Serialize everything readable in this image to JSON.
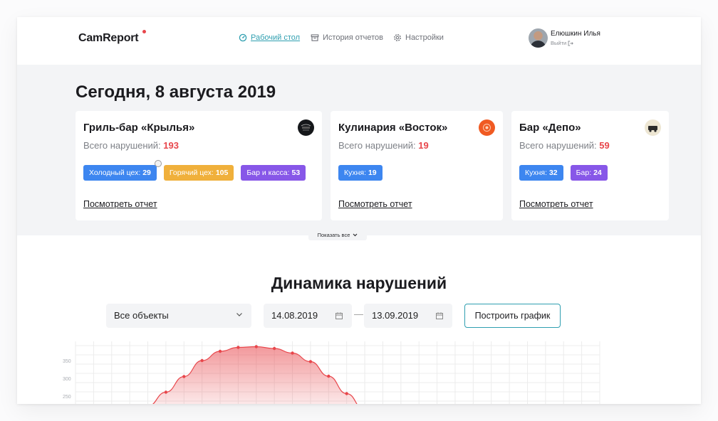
{
  "app": {
    "name": "CamReport",
    "accent": "#2f9fb0",
    "alert": "#e8464b"
  },
  "nav": {
    "dashboard": {
      "label": "Рабочий стол",
      "icon": "dashboard-icon"
    },
    "history": {
      "label": "История отчетов",
      "icon": "archive-icon"
    },
    "settings": {
      "label": "Настройки",
      "icon": "gear-icon"
    }
  },
  "user": {
    "name": "Елюшкин Илья",
    "logout": "Выйти"
  },
  "today": "Сегодня, 8 августа 2019",
  "cards": [
    {
      "title": "Гриль-бар «Крылья»",
      "total_label": "Всего нарушений:",
      "total": "193",
      "tags": [
        {
          "label": "Холодный цех:",
          "value": "29",
          "color": "blue"
        },
        {
          "label": "Горячий цех:",
          "value": "105",
          "color": "orange"
        },
        {
          "label": "Бар и касса:",
          "value": "53",
          "color": "purple"
        }
      ],
      "link": "Посмотреть отчет"
    },
    {
      "title": "Кулинария «Восток»",
      "total_label": "Всего нарушений:",
      "total": "19",
      "tags": [
        {
          "label": "Кухня:",
          "value": "19",
          "color": "blue"
        }
      ],
      "link": "Посмотреть отчет"
    },
    {
      "title": "Бар «Депо»",
      "total_label": "Всего нарушений:",
      "total": "59",
      "tags": [
        {
          "label": "Кухня:",
          "value": "32",
          "color": "blue"
        },
        {
          "label": "Бар:",
          "value": "24",
          "color": "purple"
        }
      ],
      "link": "Посмотреть отчет"
    }
  ],
  "show_all": "Показать все",
  "dynamics": {
    "title": "Динамика нарушений",
    "object_select": "Все объекты",
    "date_from": "14.08.2019",
    "date_sep": "—",
    "date_to": "13.09.2019",
    "build_button": "Построить график"
  },
  "chart_data": {
    "type": "area",
    "y_ticks": [
      250,
      300,
      350
    ],
    "series": [
      {
        "values": [
          222,
          261,
          305,
          350,
          376,
          387,
          389,
          384,
          371,
          347,
          306,
          257,
          210
        ]
      }
    ],
    "color": "#e8464b",
    "grid": true
  }
}
